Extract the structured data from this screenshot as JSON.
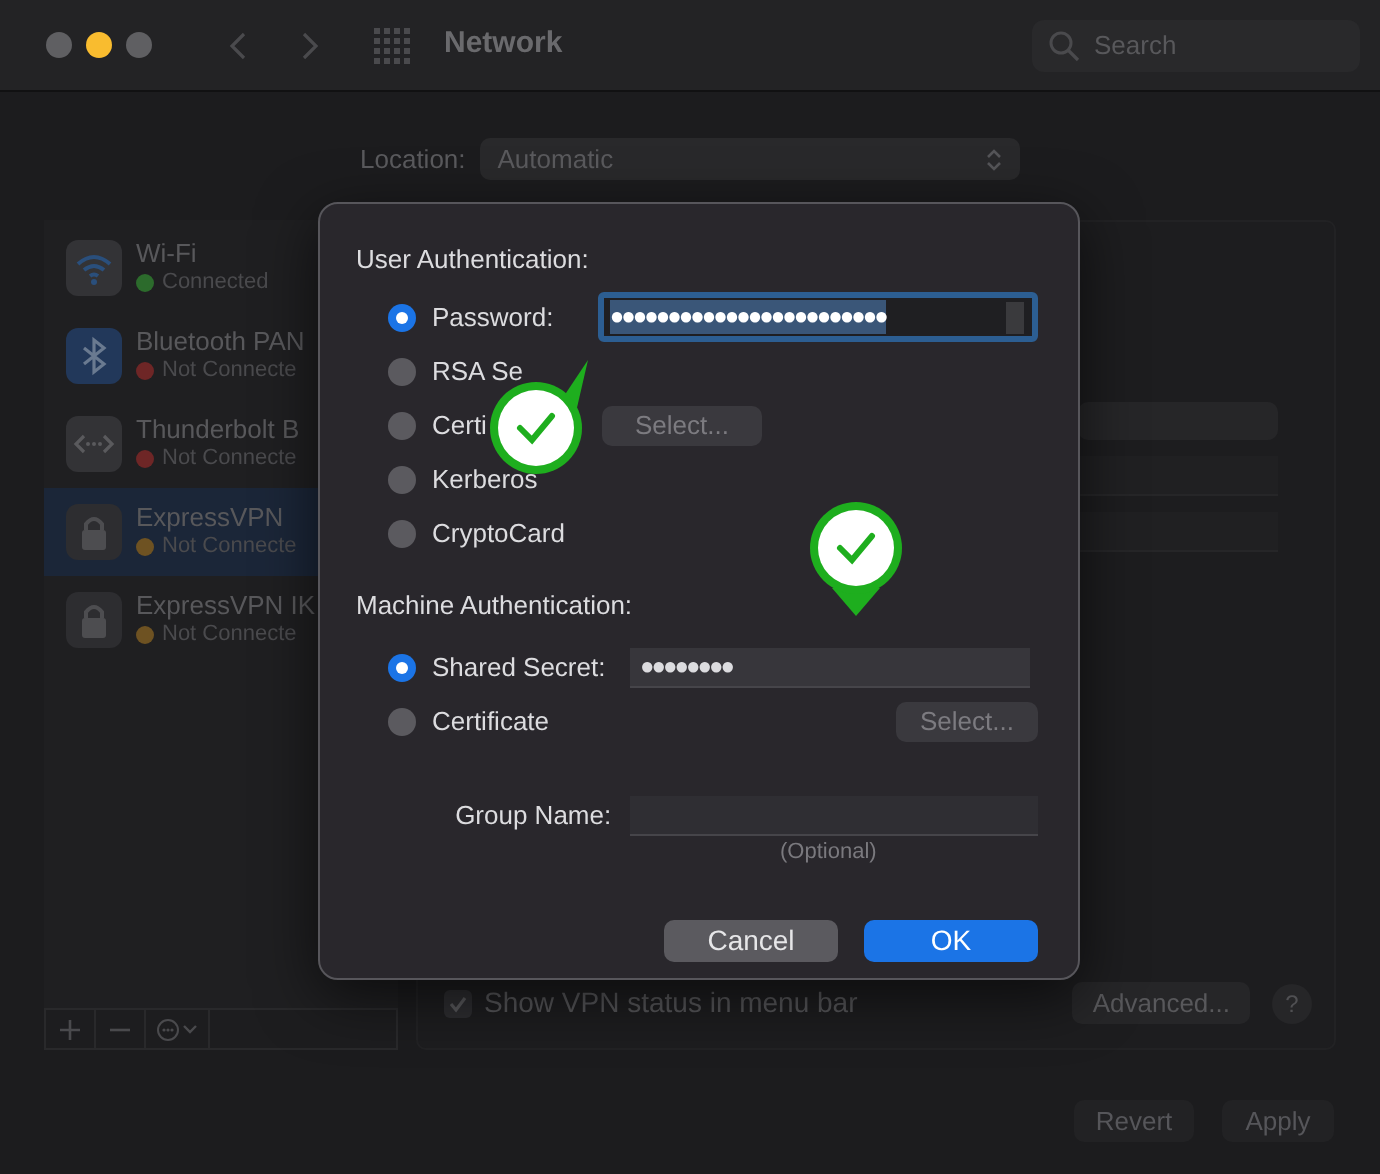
{
  "window": {
    "title": "Network",
    "search": {
      "placeholder": "Search"
    }
  },
  "location": {
    "label": "Location:",
    "value": "Automatic"
  },
  "services": [
    {
      "name": "Wi-Fi",
      "status": "Connected",
      "color": "#2c6b2c",
      "kind": "wifi",
      "selected": false
    },
    {
      "name": "Bluetooth PAN",
      "status": "Not Connecte",
      "color": "#6e2626",
      "kind": "bluetooth",
      "selected": false
    },
    {
      "name": "Thunderbolt B",
      "status": "Not Connecte",
      "color": "#6e2626",
      "kind": "thunderbolt",
      "selected": false
    },
    {
      "name": "ExpressVPN",
      "status": "Not Connecte",
      "color": "#6e5222",
      "kind": "vpn",
      "selected": true
    },
    {
      "name": "ExpressVPN IK",
      "status": "Not Connecte",
      "color": "#6e5222",
      "kind": "vpn",
      "selected": false
    }
  ],
  "vpn_status_checkbox": {
    "label": "Show VPN status in menu bar",
    "checked": true
  },
  "advanced_button": "Advanced...",
  "help_button": "?",
  "revert_button": "Revert",
  "apply_button": "Apply",
  "dialog": {
    "user_auth": {
      "heading": "User Authentication:",
      "options": [
        {
          "label": "Password:",
          "selected": true
        },
        {
          "label": "RSA Se",
          "selected": false
        },
        {
          "label": "Certi",
          "selected": false
        },
        {
          "label": "Kerberos",
          "selected": false
        },
        {
          "label": "CryptoCard",
          "selected": false
        }
      ],
      "password": "●●●●●●●●●●●●●●●●●●●●●●●●",
      "certificate_select": "Select..."
    },
    "machine_auth": {
      "heading": "Machine Authentication:",
      "options": [
        {
          "label": "Shared Secret:",
          "selected": true
        },
        {
          "label": "Certificate",
          "selected": false
        }
      ],
      "shared_secret": "●●●●●●●●",
      "certificate_select": "Select..."
    },
    "group_name": {
      "label": "Group Name:",
      "hint": "(Optional)"
    },
    "cancel_button": "Cancel",
    "ok_button": "OK"
  },
  "annotations": [
    {
      "kind": "check"
    },
    {
      "kind": "check"
    }
  ]
}
